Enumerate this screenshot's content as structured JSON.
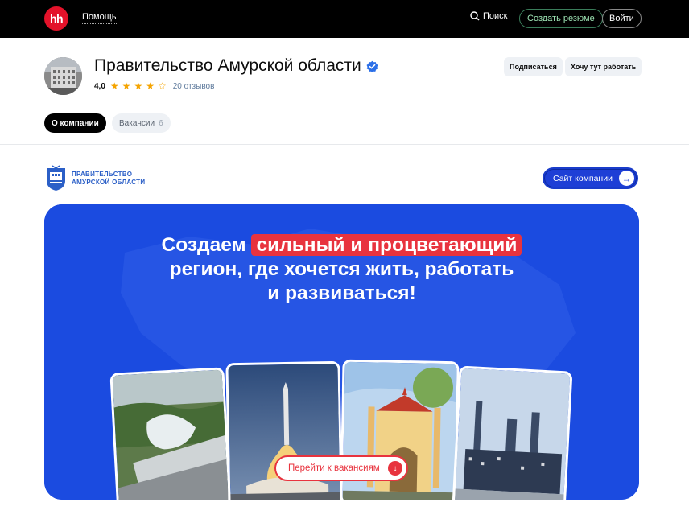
{
  "topbar": {
    "logo_text": "hh",
    "help_label": "Помощь",
    "search_label": "Поиск",
    "create_resume_label": "Создать резюме",
    "login_label": "Войти"
  },
  "company": {
    "name": "Правительство Амурской области",
    "rating": "4,0",
    "stars_filled": 4,
    "stars_total": 5,
    "reviews_label": "20 отзывов",
    "subscribe_label": "Подписаться",
    "want_work_label": "Хочу тут работать"
  },
  "tabs": [
    {
      "label": "О компании",
      "count": "",
      "active": true
    },
    {
      "label": "Вакансии",
      "count": "6",
      "active": false
    }
  ],
  "branding": {
    "line1": "ПРАВИТЕЛЬСТВО",
    "line2": "АМУРСКОЙ ОБЛАСТИ",
    "site_button_label": "Сайт компании"
  },
  "banner": {
    "headline_pre": "Создаем",
    "headline_highlight": "сильный и процветающий",
    "headline_line2": "регион, где хочется жить, работать",
    "headline_line3": "и развиваться!",
    "jobs_button_label": "Перейти к вакансиям"
  },
  "colors": {
    "brand_red": "#e3122a",
    "banner_blue": "#1b4be0",
    "accent_red": "#e8333e",
    "star": "#f5a400",
    "link_blue": "#2b5fc7"
  }
}
